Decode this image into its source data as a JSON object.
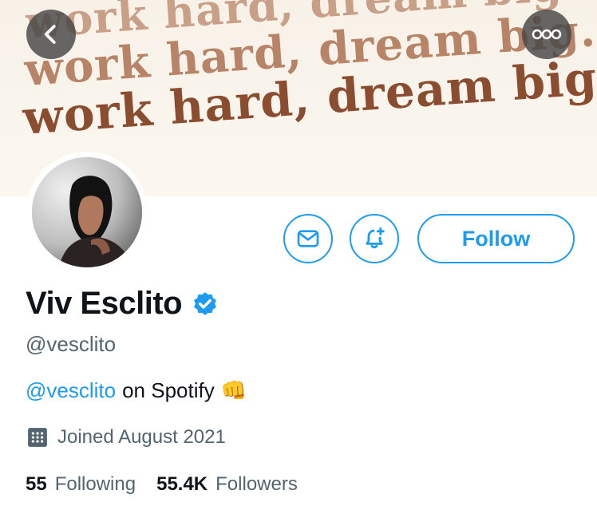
{
  "banner": {
    "lines": [
      "work hard, dream big.",
      "work hard, dream big.",
      "work hard, dream big."
    ]
  },
  "top_actions": {
    "back_icon": "chevron-left-icon",
    "more_icon": "more-horizontal-icon"
  },
  "profile_actions": {
    "message_icon": "mail-icon",
    "notify_icon": "bell-plus-icon",
    "follow_label": "Follow"
  },
  "profile": {
    "name": "Viv Esclito",
    "verified_icon": "verified-badge-icon",
    "handle": "@vesclito",
    "bio_mention": "@vesclito",
    "bio_text": "on Spotify",
    "bio_emoji": "👊",
    "joined_text": "Joined August 2021"
  },
  "stats": {
    "following_count": "55",
    "following_label": "Following",
    "followers_count": "55.4K",
    "followers_label": "Followers"
  },
  "colors": {
    "accent": "#1d9bf0",
    "text": "#0f1419",
    "muted": "#536471",
    "banner_text": "#8b4d30"
  }
}
